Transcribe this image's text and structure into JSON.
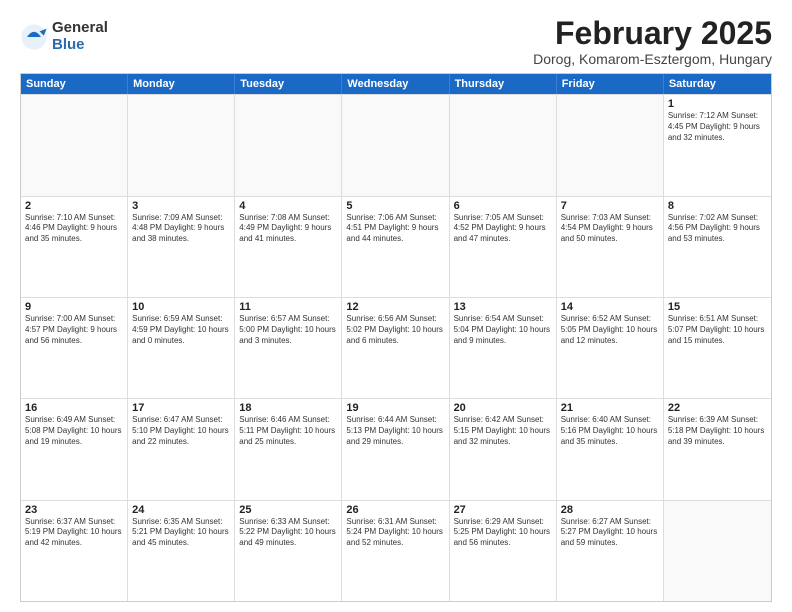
{
  "logo": {
    "general": "General",
    "blue": "Blue"
  },
  "title": "February 2025",
  "location": "Dorog, Komarom-Esztergom, Hungary",
  "weekdays": [
    "Sunday",
    "Monday",
    "Tuesday",
    "Wednesday",
    "Thursday",
    "Friday",
    "Saturday"
  ],
  "rows": [
    [
      {
        "day": "",
        "info": ""
      },
      {
        "day": "",
        "info": ""
      },
      {
        "day": "",
        "info": ""
      },
      {
        "day": "",
        "info": ""
      },
      {
        "day": "",
        "info": ""
      },
      {
        "day": "",
        "info": ""
      },
      {
        "day": "1",
        "info": "Sunrise: 7:12 AM\nSunset: 4:45 PM\nDaylight: 9 hours and 32 minutes."
      }
    ],
    [
      {
        "day": "2",
        "info": "Sunrise: 7:10 AM\nSunset: 4:46 PM\nDaylight: 9 hours and 35 minutes."
      },
      {
        "day": "3",
        "info": "Sunrise: 7:09 AM\nSunset: 4:48 PM\nDaylight: 9 hours and 38 minutes."
      },
      {
        "day": "4",
        "info": "Sunrise: 7:08 AM\nSunset: 4:49 PM\nDaylight: 9 hours and 41 minutes."
      },
      {
        "day": "5",
        "info": "Sunrise: 7:06 AM\nSunset: 4:51 PM\nDaylight: 9 hours and 44 minutes."
      },
      {
        "day": "6",
        "info": "Sunrise: 7:05 AM\nSunset: 4:52 PM\nDaylight: 9 hours and 47 minutes."
      },
      {
        "day": "7",
        "info": "Sunrise: 7:03 AM\nSunset: 4:54 PM\nDaylight: 9 hours and 50 minutes."
      },
      {
        "day": "8",
        "info": "Sunrise: 7:02 AM\nSunset: 4:56 PM\nDaylight: 9 hours and 53 minutes."
      }
    ],
    [
      {
        "day": "9",
        "info": "Sunrise: 7:00 AM\nSunset: 4:57 PM\nDaylight: 9 hours and 56 minutes."
      },
      {
        "day": "10",
        "info": "Sunrise: 6:59 AM\nSunset: 4:59 PM\nDaylight: 10 hours and 0 minutes."
      },
      {
        "day": "11",
        "info": "Sunrise: 6:57 AM\nSunset: 5:00 PM\nDaylight: 10 hours and 3 minutes."
      },
      {
        "day": "12",
        "info": "Sunrise: 6:56 AM\nSunset: 5:02 PM\nDaylight: 10 hours and 6 minutes."
      },
      {
        "day": "13",
        "info": "Sunrise: 6:54 AM\nSunset: 5:04 PM\nDaylight: 10 hours and 9 minutes."
      },
      {
        "day": "14",
        "info": "Sunrise: 6:52 AM\nSunset: 5:05 PM\nDaylight: 10 hours and 12 minutes."
      },
      {
        "day": "15",
        "info": "Sunrise: 6:51 AM\nSunset: 5:07 PM\nDaylight: 10 hours and 15 minutes."
      }
    ],
    [
      {
        "day": "16",
        "info": "Sunrise: 6:49 AM\nSunset: 5:08 PM\nDaylight: 10 hours and 19 minutes."
      },
      {
        "day": "17",
        "info": "Sunrise: 6:47 AM\nSunset: 5:10 PM\nDaylight: 10 hours and 22 minutes."
      },
      {
        "day": "18",
        "info": "Sunrise: 6:46 AM\nSunset: 5:11 PM\nDaylight: 10 hours and 25 minutes."
      },
      {
        "day": "19",
        "info": "Sunrise: 6:44 AM\nSunset: 5:13 PM\nDaylight: 10 hours and 29 minutes."
      },
      {
        "day": "20",
        "info": "Sunrise: 6:42 AM\nSunset: 5:15 PM\nDaylight: 10 hours and 32 minutes."
      },
      {
        "day": "21",
        "info": "Sunrise: 6:40 AM\nSunset: 5:16 PM\nDaylight: 10 hours and 35 minutes."
      },
      {
        "day": "22",
        "info": "Sunrise: 6:39 AM\nSunset: 5:18 PM\nDaylight: 10 hours and 39 minutes."
      }
    ],
    [
      {
        "day": "23",
        "info": "Sunrise: 6:37 AM\nSunset: 5:19 PM\nDaylight: 10 hours and 42 minutes."
      },
      {
        "day": "24",
        "info": "Sunrise: 6:35 AM\nSunset: 5:21 PM\nDaylight: 10 hours and 45 minutes."
      },
      {
        "day": "25",
        "info": "Sunrise: 6:33 AM\nSunset: 5:22 PM\nDaylight: 10 hours and 49 minutes."
      },
      {
        "day": "26",
        "info": "Sunrise: 6:31 AM\nSunset: 5:24 PM\nDaylight: 10 hours and 52 minutes."
      },
      {
        "day": "27",
        "info": "Sunrise: 6:29 AM\nSunset: 5:25 PM\nDaylight: 10 hours and 56 minutes."
      },
      {
        "day": "28",
        "info": "Sunrise: 6:27 AM\nSunset: 5:27 PM\nDaylight: 10 hours and 59 minutes."
      },
      {
        "day": "",
        "info": ""
      }
    ]
  ]
}
